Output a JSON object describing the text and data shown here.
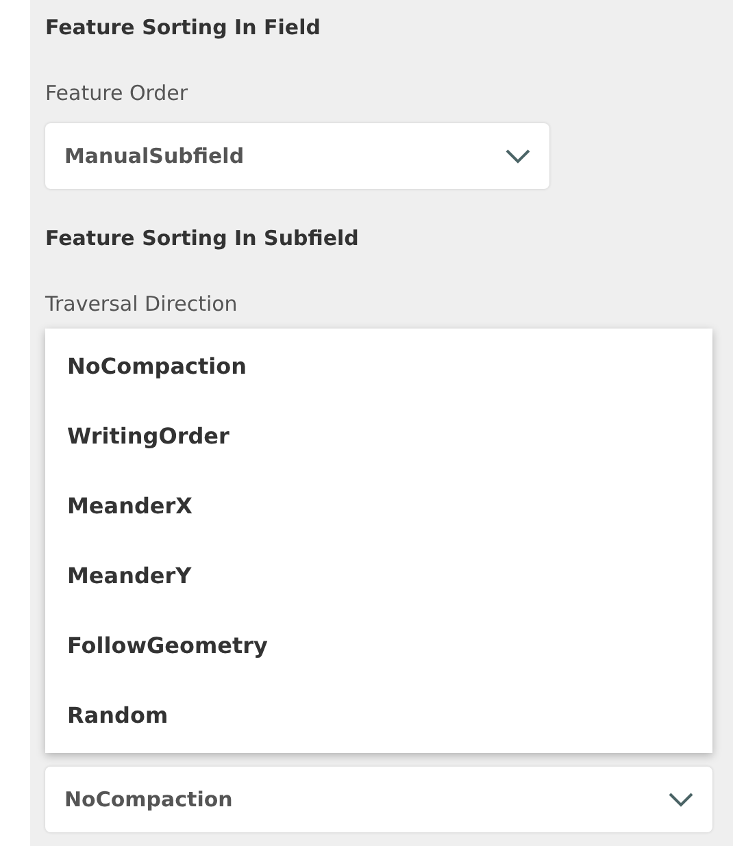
{
  "field_section": {
    "heading": "Feature Sorting In Field",
    "label": "Feature Order",
    "select": {
      "value": "ManualSubfield"
    }
  },
  "subfield_section": {
    "heading": "Feature Sorting In Subfield",
    "label": "Traversal Direction",
    "menu": {
      "options": [
        "NoCompaction",
        "WritingOrder",
        "MeanderX",
        "MeanderY",
        "FollowGeometry",
        "Random"
      ]
    }
  },
  "lower_select": {
    "value": "NoCompaction"
  }
}
